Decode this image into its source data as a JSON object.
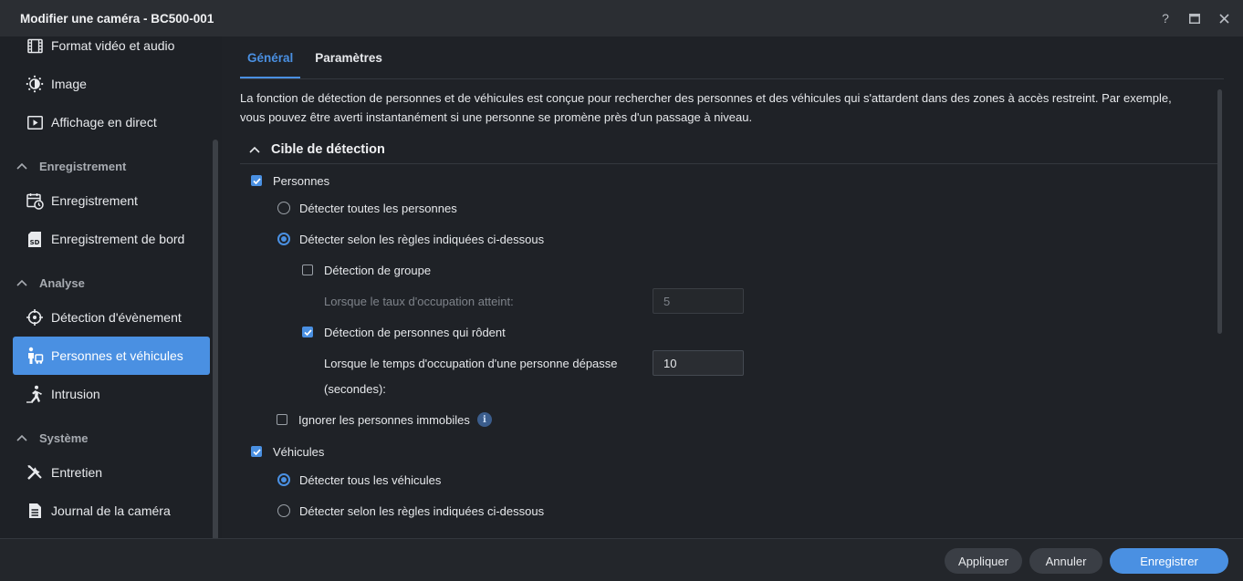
{
  "window": {
    "title": "Modifier une caméra - BC500-001",
    "help_label": "?",
    "maximize_label": "▣",
    "close_label": "✕"
  },
  "sidebar": {
    "items": [
      {
        "label": "Format vidéo et audio",
        "icon": "film-icon"
      },
      {
        "label": "Image",
        "icon": "brightness-icon"
      },
      {
        "label": "Affichage en direct",
        "icon": "play-icon"
      },
      {
        "label": "Enregistrement",
        "icon": "calendar-clock-icon"
      },
      {
        "label": "Enregistrement de bord",
        "icon": "sd-card-icon"
      },
      {
        "label": "Détection d'évènement",
        "icon": "crosshair-icon"
      },
      {
        "label": "Personnes et véhicules",
        "icon": "person-vehicle-icon"
      },
      {
        "label": "Intrusion",
        "icon": "running-person-icon"
      },
      {
        "label": "Entretien",
        "icon": "tools-icon"
      },
      {
        "label": "Journal de la caméra",
        "icon": "log-icon"
      }
    ],
    "groups": [
      "Enregistrement",
      "Analyse",
      "Système"
    ],
    "active_item": "Personnes et véhicules"
  },
  "tabs": [
    {
      "label": "Général",
      "active": true
    },
    {
      "label": "Paramètres",
      "active": false
    }
  ],
  "content": {
    "description": "La fonction de détection de personnes et de véhicules est conçue pour rechercher des personnes et des véhicules qui s'attardent dans des zones à accès restreint. Par exemple, vous pouvez être averti instantanément si une personne se promène près d'un passage à niveau.",
    "section_title": "Cible de détection",
    "persons": {
      "label": "Personnes",
      "checked": true,
      "option_all": "Détecter toutes les personnes",
      "option_rules": "Détecter selon les règles indiquées ci-dessous",
      "group_detection": "Détection de groupe",
      "group_threshold_label": "Lorsque le taux d'occupation atteint:",
      "group_threshold_value": "5",
      "loitering_detection": "Détection de personnes qui rôdent",
      "loitering_time_label_line1": "Lorsque le temps d'occupation d'une personne dépasse",
      "loitering_time_label_line2": "(secondes):",
      "loitering_time_value": "10",
      "ignore_stationary": "Ignorer les personnes immobiles",
      "info_glyph": "i"
    },
    "vehicles": {
      "label": "Véhicules",
      "checked": true,
      "option_all": "Détecter tous les véhicules",
      "option_rules": "Détecter selon les règles indiquées ci-dessous"
    }
  },
  "footer": {
    "apply_label": "Appliquer",
    "cancel_label": "Annuler",
    "save_label": "Enregistrer"
  },
  "colors": {
    "accent": "#4a90e2",
    "background": "#1e2126",
    "titlebar": "#2b2e33"
  }
}
